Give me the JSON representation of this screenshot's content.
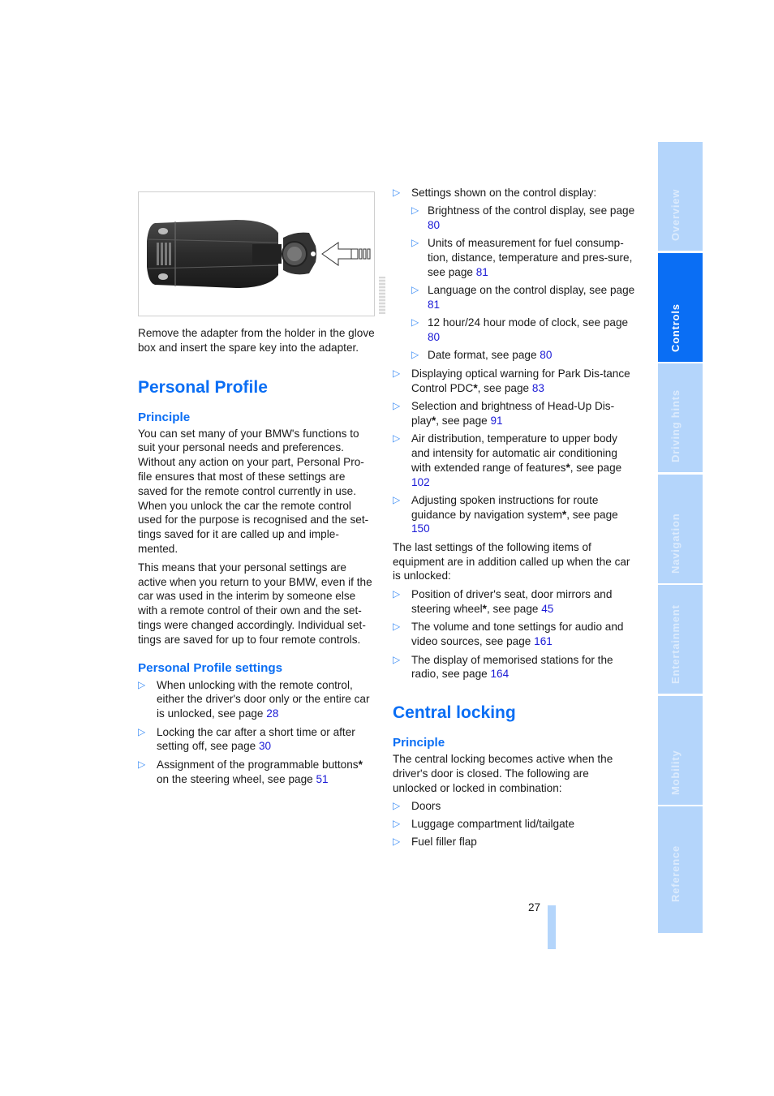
{
  "figure": {
    "alt": "Remote control key adapter with spare key being inserted",
    "icon": "key-adapter-illustration"
  },
  "left": {
    "caption": "Remove the adapter from the holder in the glove box and insert the spare key into the adapter.",
    "section_title": "Personal Profile",
    "principle_title": "Principle",
    "principle_p1_lines": [
      "You can set many of your BMW's functions to",
      "suit your personal needs and preferences.",
      "Without any action on your part, Personal Pro-",
      "file ensures that most of these settings are",
      "saved for the remote control currently in use.",
      "When you unlock the car the remote control",
      "used for the purpose is recognised and the set-",
      "tings saved for it are called up and imple-",
      "mented."
    ],
    "principle_p2_lines": [
      "This means that your personal settings are",
      "active when you return to your BMW, even if the",
      "car was used in the interim by someone else",
      "with a remote control of their own and the set-",
      "tings were changed accordingly. Individual set-",
      "tings are saved for up to four remote controls."
    ],
    "settings_title": "Personal Profile settings",
    "settings_items": [
      {
        "text": "When unlocking with the remote control, either the driver's door only or the entire car is unlocked, see page ",
        "star": "",
        "page": "28"
      },
      {
        "text": "Locking the car after a short time or after setting off, see page ",
        "star": "",
        "page": "30"
      },
      {
        "text": "Assignment of the programmable buttons",
        "star": "*",
        "text2": " on the steering wheel, see page ",
        "page": "51"
      }
    ]
  },
  "right": {
    "settings_display": {
      "text": "Settings shown on the control display:",
      "sub": [
        {
          "text": "Brightness of the control display, see page ",
          "page": "80"
        },
        {
          "text": "Units of measurement for fuel consump-tion, distance, temperature and pres-sure, see page ",
          "page": "81"
        },
        {
          "text": "Language on the control display, see page ",
          "page": "81"
        },
        {
          "text": "12 hour/24 hour mode of clock, see page ",
          "page": "80"
        },
        {
          "text": "Date format, see page ",
          "page": "80"
        }
      ]
    },
    "items": [
      {
        "text": "Displaying optical warning for Park Dis-tance Control PDC",
        "star": "*",
        "text2": ", see page ",
        "page": "83"
      },
      {
        "text": "Selection and brightness of Head-Up Dis-play",
        "star": "*",
        "text2": ", see page ",
        "page": "91"
      },
      {
        "text": "Air distribution, temperature to upper body and intensity for automatic air conditioning with extended range of features",
        "star": "*",
        "text2": ", see page ",
        "page": "102"
      },
      {
        "text": "Adjusting spoken instructions for route guidance by navigation system",
        "star": "*",
        "text2": ", see page ",
        "page": "150"
      }
    ],
    "last_settings_intro": "The last settings of the following items of equipment are in addition called up when the car is unlocked:",
    "last_items": [
      {
        "text": "Position of driver's seat, door mirrors and steering wheel",
        "star": "*",
        "text2": ", see page ",
        "page": "45"
      },
      {
        "text": "The volume and tone settings for audio and video sources, see page ",
        "star": "",
        "text2": "",
        "page": "161"
      },
      {
        "text": "The display of memorised stations for the radio, see page ",
        "star": "",
        "text2": "",
        "page": "164"
      }
    ],
    "central_title": "Central locking",
    "central_principle_title": "Principle",
    "central_text": "The central locking becomes active when the driver's door is closed. The following are unlocked or locked in combination:",
    "central_items": [
      "Doors",
      "Luggage compartment lid/tailgate",
      "Fuel filler flap"
    ]
  },
  "sidebar": {
    "tabs": [
      {
        "label": "Overview",
        "active": false
      },
      {
        "label": "Controls",
        "active": true
      },
      {
        "label": "Driving hints",
        "active": false
      },
      {
        "label": "Navigation",
        "active": false
      },
      {
        "label": "Entertainment",
        "active": false
      },
      {
        "label": "Mobility",
        "active": false
      },
      {
        "label": "Reference",
        "active": false
      }
    ]
  },
  "footer": {
    "page_number": "27"
  },
  "colors": {
    "accent": "#0a6ef4",
    "tab_inactive": "#b4d5fb",
    "link": "#1b1bd6",
    "bullet": "#3b8cf5"
  }
}
